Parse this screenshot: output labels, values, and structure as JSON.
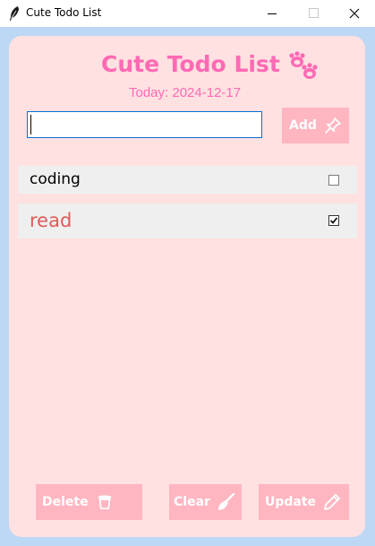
{
  "window": {
    "title": "Cute Todo List"
  },
  "header": {
    "title": "Cute Todo List",
    "date": "Today: 2024-12-17"
  },
  "input": {
    "value": "",
    "placeholder": ""
  },
  "buttons": {
    "add": "Add",
    "delete": "Delete",
    "clear": "Clear",
    "update": "Update"
  },
  "tasks": [
    {
      "label": "coding",
      "checked": false
    },
    {
      "label": "read",
      "checked": true
    }
  ],
  "icons": {
    "title_bar": "feather-icon",
    "header": "paw-icon",
    "add": "pushpin-icon",
    "delete": "trash-icon",
    "clear": "broom-icon",
    "update": "pencil-icon"
  },
  "colors": {
    "window_bg": "#bcd8f5",
    "card_bg": "#ffe1e1",
    "accent": "#ff69b4",
    "button_bg": "#ffb6c1",
    "row_bg": "#efefef",
    "done_text": "#e05a5a"
  }
}
